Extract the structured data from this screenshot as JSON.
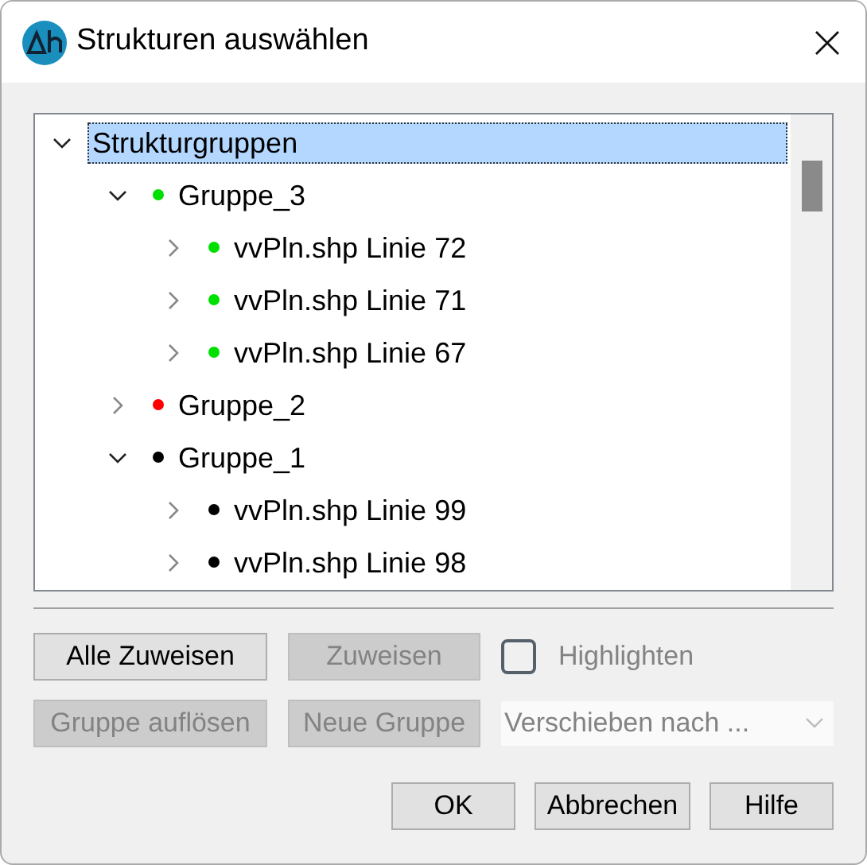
{
  "window": {
    "title": "Strukturen auswählen"
  },
  "tree": {
    "nodes": [
      {
        "label": "Strukturgruppen",
        "selected": true,
        "expanded": true,
        "children": [
          {
            "label": "Gruppe_3",
            "color": "#00e000",
            "selected": false,
            "expanded": true,
            "children": [
              {
                "label": "vvPln.shp Linie 72",
                "color": "#00e000",
                "selected": false,
                "expanded": false
              },
              {
                "label": "vvPln.shp Linie 71",
                "color": "#00e000",
                "selected": false,
                "expanded": false
              },
              {
                "label": "vvPln.shp Linie 67",
                "color": "#00e000",
                "selected": false,
                "expanded": false
              }
            ]
          },
          {
            "label": "Gruppe_2",
            "color": "#ff0000",
            "selected": false,
            "expanded": false
          },
          {
            "label": "Gruppe_1",
            "color": "#000000",
            "selected": false,
            "expanded": true,
            "children": [
              {
                "label": "vvPln.shp Linie 99",
                "color": "#000000",
                "selected": false,
                "expanded": false
              },
              {
                "label": "vvPln.shp Linie 98",
                "color": "#000000",
                "selected": false,
                "expanded": false
              }
            ]
          }
        ]
      }
    ]
  },
  "row1": {
    "buttons": [
      {
        "label": "Alle Zuweisen",
        "disabled": false
      },
      {
        "label": "Zuweisen",
        "disabled": true
      }
    ],
    "checkbox": {
      "label": "Highlighten",
      "checked": false,
      "disabled": true
    }
  },
  "row2": {
    "buttons": [
      {
        "label": "Gruppe auflösen",
        "disabled": true
      },
      {
        "label": "Neue Gruppe",
        "disabled": true
      }
    ],
    "dropdown": {
      "placeholder": "Verschieben nach ...",
      "disabled": true
    }
  },
  "footer": {
    "buttons": [
      {
        "label": "OK",
        "disabled": false
      },
      {
        "label": "Abbrechen",
        "disabled": false
      },
      {
        "label": "Hilfe",
        "disabled": false
      }
    ]
  }
}
